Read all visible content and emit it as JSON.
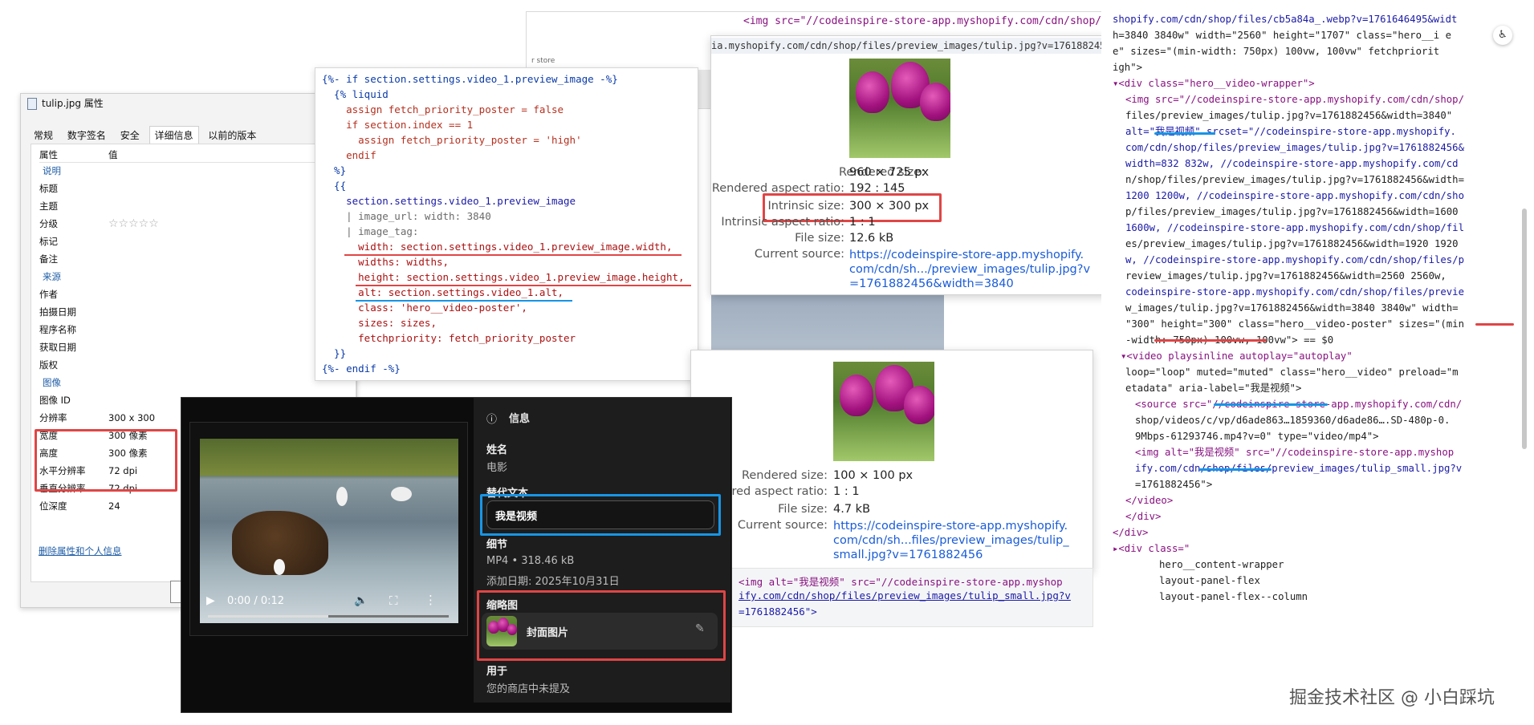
{
  "properties_dialog": {
    "title": "tulip.jpg 属性",
    "tabs": [
      "常规",
      "数字签名",
      "安全",
      "详细信息",
      "以前的版本"
    ],
    "columns": [
      "属性",
      "值"
    ],
    "groups": {
      "description": "说明",
      "origin": "来源",
      "image": "图像"
    },
    "description_rows": [
      "标题",
      "主题",
      "分级",
      "标记",
      "备注"
    ],
    "rating_stars": "☆☆☆☆☆",
    "origin_rows": [
      "作者",
      "拍摄日期",
      "程序名称",
      "获取日期",
      "版权"
    ],
    "image_rows": [
      {
        "name": "图像 ID",
        "value": ""
      },
      {
        "name": "分辨率",
        "value": "300 x 300"
      },
      {
        "name": "宽度",
        "value": "300 像素"
      },
      {
        "name": "高度",
        "value": "300 像素"
      },
      {
        "name": "水平分辨率",
        "value": "72 dpi"
      },
      {
        "name": "垂直分辨率",
        "value": "72 dpi"
      },
      {
        "name": "位深度",
        "value": "24"
      }
    ],
    "remove_link": "删除属性和个人信息"
  },
  "liquid_code": {
    "lines": [
      "{%- if section.settings.video_1.preview_image -%}",
      "  {% liquid",
      "    assign fetch_priority_poster = false",
      "    if section.index == 1",
      "      assign fetch_priority_poster = 'high'",
      "    endif",
      "  %}",
      "  {{",
      "    section.settings.video_1.preview_image",
      "    | image_url: width: 3840",
      "    | image_tag:",
      "      width: section.settings.video_1.preview_image.width,",
      "      widths: widths,",
      "      height: section.settings.video_1.preview_image.height,",
      "      alt: section.settings.video_1.alt,",
      "      class: 'hero__video-poster',",
      "      sizes: sizes,",
      "      fetchpriority: fetch_priority_poster",
      "  }}",
      "{%- endif -%}"
    ]
  },
  "top_strip": {
    "code_line": "<img src=\"//codeinspire-store-app.myshopify.com/cdn/shop/",
    "url_line": "ia.myshopify.com/cdn/shop/files/preview_images/tulip.jpg?v=1761882456&width=3840",
    "store_label": "r store"
  },
  "tooltip_large": {
    "rendered_size_label": "Rendered size:",
    "rendered_size": "960 × 725 px",
    "aspect_label": "Rendered aspect ratio:",
    "aspect": "192 : 145",
    "intrinsic_label": "Intrinsic size:",
    "intrinsic": "300 × 300 px",
    "intrinsic_aspect_label": "Intrinsic aspect ratio:",
    "intrinsic_aspect": "1 : 1",
    "file_size_label": "File size:",
    "file_size": "12.6 kB",
    "source_label": "Current source:",
    "source_lines": [
      "https://codeinspire-store-app.myshopify.",
      "com/cdn/sh.../preview_images/tulip.jpg?v",
      "=1761882456&width=3840"
    ]
  },
  "tooltip_small": {
    "rendered_size_label": "Rendered size:",
    "rendered_size": "100 × 100 px",
    "aspect_label": "red aspect ratio:",
    "aspect": "1 : 1",
    "file_size_label": "File size:",
    "file_size": "4.7 kB",
    "source_label": "Current source:",
    "source_lines": [
      "https://codeinspire-store-app.myshopify.",
      "com/cdn/sh...files/preview_images/tulip_",
      "small.jpg?v=1761882456"
    ],
    "img_code_lines": [
      "<img alt=\"我是视频\" src=\"//codeinspire-store-app.myshop",
      "ify.com/cdn/shop/files/preview_images/tulip_small.jpg?v",
      "=1761882456\">"
    ]
  },
  "video_panel": {
    "time": "0:00 / 0:12",
    "progress": 0.5,
    "info_title": "信息",
    "name_label": "姓名",
    "name_value": "电影",
    "alt_label": "替代文本",
    "alt_value": "我是视频",
    "details_label": "细节",
    "details_meta": "MP4 • 318.46 kB",
    "added_date": "添加日期: 2025年10月31日",
    "thumbnail_label": "缩略图",
    "thumbnail_name": "封面图片",
    "usage_label": "用于",
    "usage_value": "您的商店中未提及"
  },
  "dom_panel": {
    "lines": [
      "shopify.com/cdn/shop/files/cb5a84a_.webp?v=1761646495&widt",
      "h=3840 3840w\" width=\"2560\" height=\"1707\" class=\"hero__i  e",
      "e\" sizes=\"(min-width: 750px) 100vw, 100vw\" fetchpriorit",
      "igh\">",
      "▾<div class=\"hero__video-wrapper\">",
      "<img src=\"//codeinspire-store-app.myshopify.com/cdn/shop/",
      "files/preview_images/tulip.jpg?v=1761882456&width=3840\"",
      "alt=\"我是视频\" srcset=\"//codeinspire-store-app.myshopify.",
      "com/cdn/shop/files/preview_images/tulip.jpg?v=1761882456&",
      "width=832 832w, //codeinspire-store-app.myshopify.com/cd",
      "n/shop/files/preview_images/tulip.jpg?v=1761882456&width=",
      "1200 1200w, //codeinspire-store-app.myshopify.com/cdn/sho",
      "p/files/preview_images/tulip.jpg?v=1761882456&width=1600",
      "1600w, //codeinspire-store-app.myshopify.com/cdn/shop/fil",
      "es/preview_images/tulip.jpg?v=1761882456&width=1920 1920",
      "w, //codeinspire-store-app.myshopify.com/cdn/shop/files/p",
      "review_images/tulip.jpg?v=1761882456&width=2560 2560w,",
      "codeinspire-store-app.myshopify.com/cdn/shop/files/previe",
      "w_images/tulip.jpg?v=1761882456&width=3840 3840w\" width=",
      "\"300\" height=\"300\" class=\"hero__video-poster\" sizes=\"(min",
      "-width: 750px) 100vw, 100vw\"> == $0",
      "▾<video playsinline autoplay=\"autoplay\"",
      "loop=\"loop\" muted=\"muted\" class=\"hero__video\" preload=\"m",
      "etadata\" aria-label=\"我是视频\">",
      "<source src=\"//codeinspire-store-app.myshopify.com/cdn/",
      "shop/videos/c/vp/d6ade863…1859360/d6ade86….SD-480p-0.",
      "9Mbps-61293746.mp4?v=0\" type=\"video/mp4\">",
      "<img alt=\"我是视频\" src=\"//codeinspire-store-app.myshop",
      "ify.com/cdn/shop/files/preview_images/tulip_small.jpg?v",
      "=1761882456\">",
      "</video>",
      "</div>",
      "</div>",
      "▸<div class=\"",
      "hero__content-wrapper",
      "layout-panel-flex",
      "layout-panel-flex--column",
      "   "
    ]
  },
  "watermark": "掘金技术社区 @ 小白踩坑",
  "colors": {
    "highlight_red": "#e04545",
    "highlight_blue": "#1795e6",
    "link_blue": "#1a5cd8"
  }
}
